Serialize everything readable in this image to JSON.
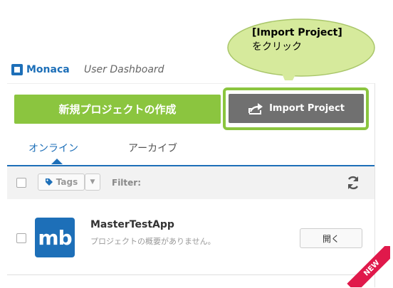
{
  "header": {
    "brand": "Monaca",
    "title": "User Dashboard"
  },
  "toolbar": {
    "new_project_label": "新規プロジェクトの作成",
    "import_project_label": "Import Project"
  },
  "callout": {
    "line1": "[Import Project]",
    "line2": "をクリック"
  },
  "tabs": [
    {
      "label": "オンライン",
      "active": true
    },
    {
      "label": "アーカイブ",
      "active": false
    }
  ],
  "filterbar": {
    "tags_label": "Tags",
    "filter_label": "Filter:"
  },
  "projects": [
    {
      "icon_text": "mb",
      "name": "MasterTestApp",
      "description": "プロジェクトの概要がありません。",
      "open_label": "開く",
      "badge": "NEW"
    }
  ],
  "colors": {
    "brand": "#1d6fb8",
    "accent_green": "#8bc53f",
    "import_gray": "#707070",
    "new_badge": "#e0194b",
    "callout_fill": "#d6ea9c"
  }
}
